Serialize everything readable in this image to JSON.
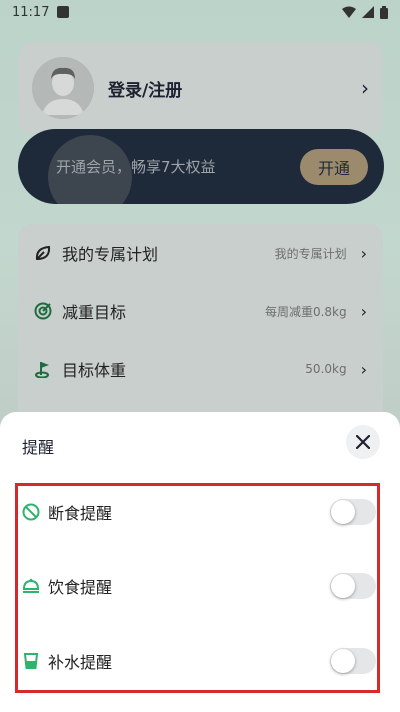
{
  "status_bar": {
    "time": "11:17",
    "icons": [
      "app-icon",
      "wifi-icon",
      "signal-icon",
      "battery-icon"
    ]
  },
  "profile": {
    "login_label": "登录/注册",
    "avatar_icon": "avatar-icon"
  },
  "vip": {
    "text": "开通会员，畅享7大权益",
    "button_label": "开通"
  },
  "menu": {
    "items": [
      {
        "label": "我的专属计划",
        "value": "我的专属计划",
        "icon": "leaf-icon"
      },
      {
        "label": "减重目标",
        "value": "每周减重0.8kg",
        "icon": "target-icon"
      },
      {
        "label": "目标体重",
        "value": "50.0kg",
        "icon": "flag-icon"
      }
    ]
  },
  "sheet": {
    "title": "提醒",
    "close_icon": "close-icon",
    "reminders": [
      {
        "label": "断食提醒",
        "icon": "no-eating-icon",
        "enabled": false
      },
      {
        "label": "饮食提醒",
        "icon": "meal-cover-icon",
        "enabled": false
      },
      {
        "label": "补水提醒",
        "icon": "water-cup-icon",
        "enabled": false
      }
    ]
  },
  "colors": {
    "accent_green": "#2fb36d",
    "highlight_red": "#d42a2a",
    "vip_dark": "#1e2a3a",
    "vip_gold": "#9c8a6d"
  }
}
